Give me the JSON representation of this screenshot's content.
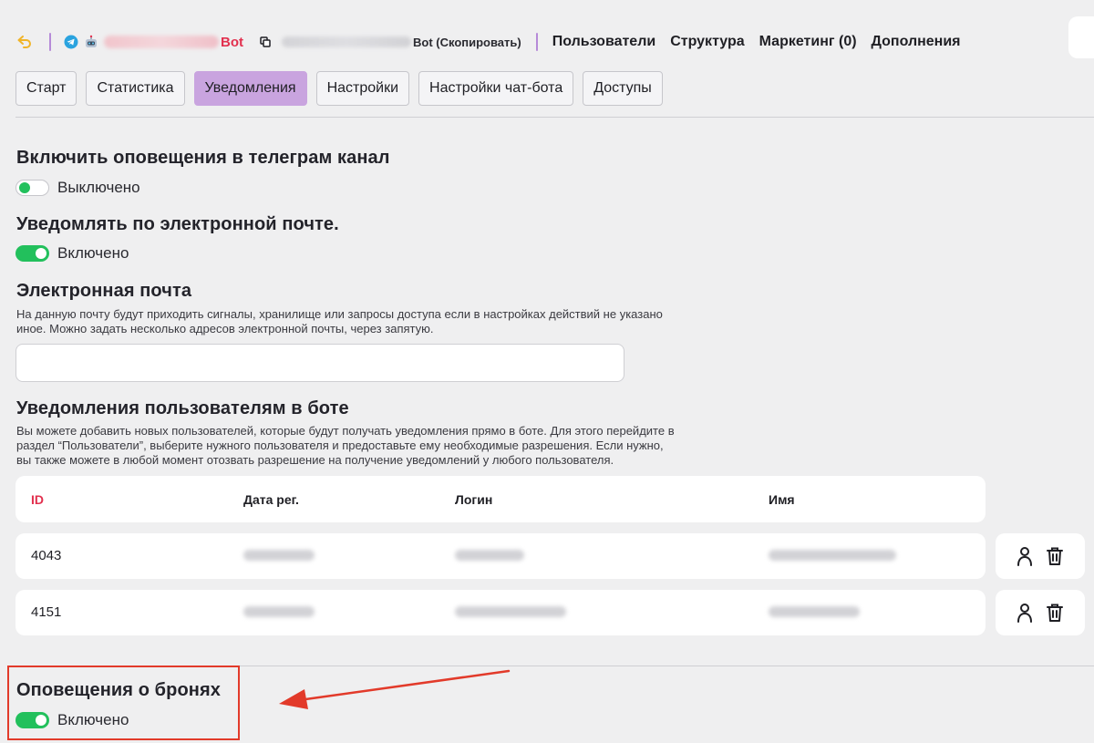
{
  "topnav": {
    "bot_name_suffix": "Bot",
    "link_suffix": "Bot (Скопировать)",
    "links": [
      "Пользователи",
      "Структура",
      "Маркетинг (0)",
      "Дополнения"
    ]
  },
  "tabs": [
    "Старт",
    "Статистика",
    "Уведомления",
    "Настройки",
    "Настройки чат-бота",
    "Доступы"
  ],
  "active_tab": "Уведомления",
  "telegram_channel": {
    "title": "Включить оповещения в телеграм канал",
    "state_label": "Выключено"
  },
  "email_notify": {
    "title": "Уведомлять по электронной почте.",
    "state_label": "Включено"
  },
  "email": {
    "title": "Электронная почта",
    "description_line1": "На данную почту будут приходить сигналы, хранилище или запросы доступа если в настройках действий не указано",
    "description_line2": "иное. Можно задать несколько адресов электронной почты, через запятую.",
    "value": ""
  },
  "bot_users": {
    "title": "Уведомления пользователям в боте",
    "description_line1": "Вы можете добавить новых пользователей, которые будут получать уведомления прямо в боте. Для этого перейдите в",
    "description_line2": "раздел “Пользователи”, выберите нужного пользователя и предоставьте ему необходимые разрешения. Если нужно,",
    "description_line3": "вы также можете в любой момент отозвать разрешение на получение уведомлений у любого пользователя.",
    "columns": [
      "ID",
      "Дата рег.",
      "Логин",
      "Имя"
    ],
    "rows": [
      {
        "id": "4043"
      },
      {
        "id": "4151"
      }
    ]
  },
  "booking_notify": {
    "title": "Оповещения о бронях",
    "state_label": "Включено"
  },
  "colors": {
    "accent_tab": "#c9a4df",
    "toggle_on": "#22c05c",
    "id_header": "#e2304e",
    "annotation": "#e23a2a"
  },
  "icons": [
    "undo-arrow-icon",
    "telegram-icon",
    "robot-icon",
    "copy-icon",
    "user-icon",
    "trash-icon",
    "annotation-arrow-icon"
  ]
}
